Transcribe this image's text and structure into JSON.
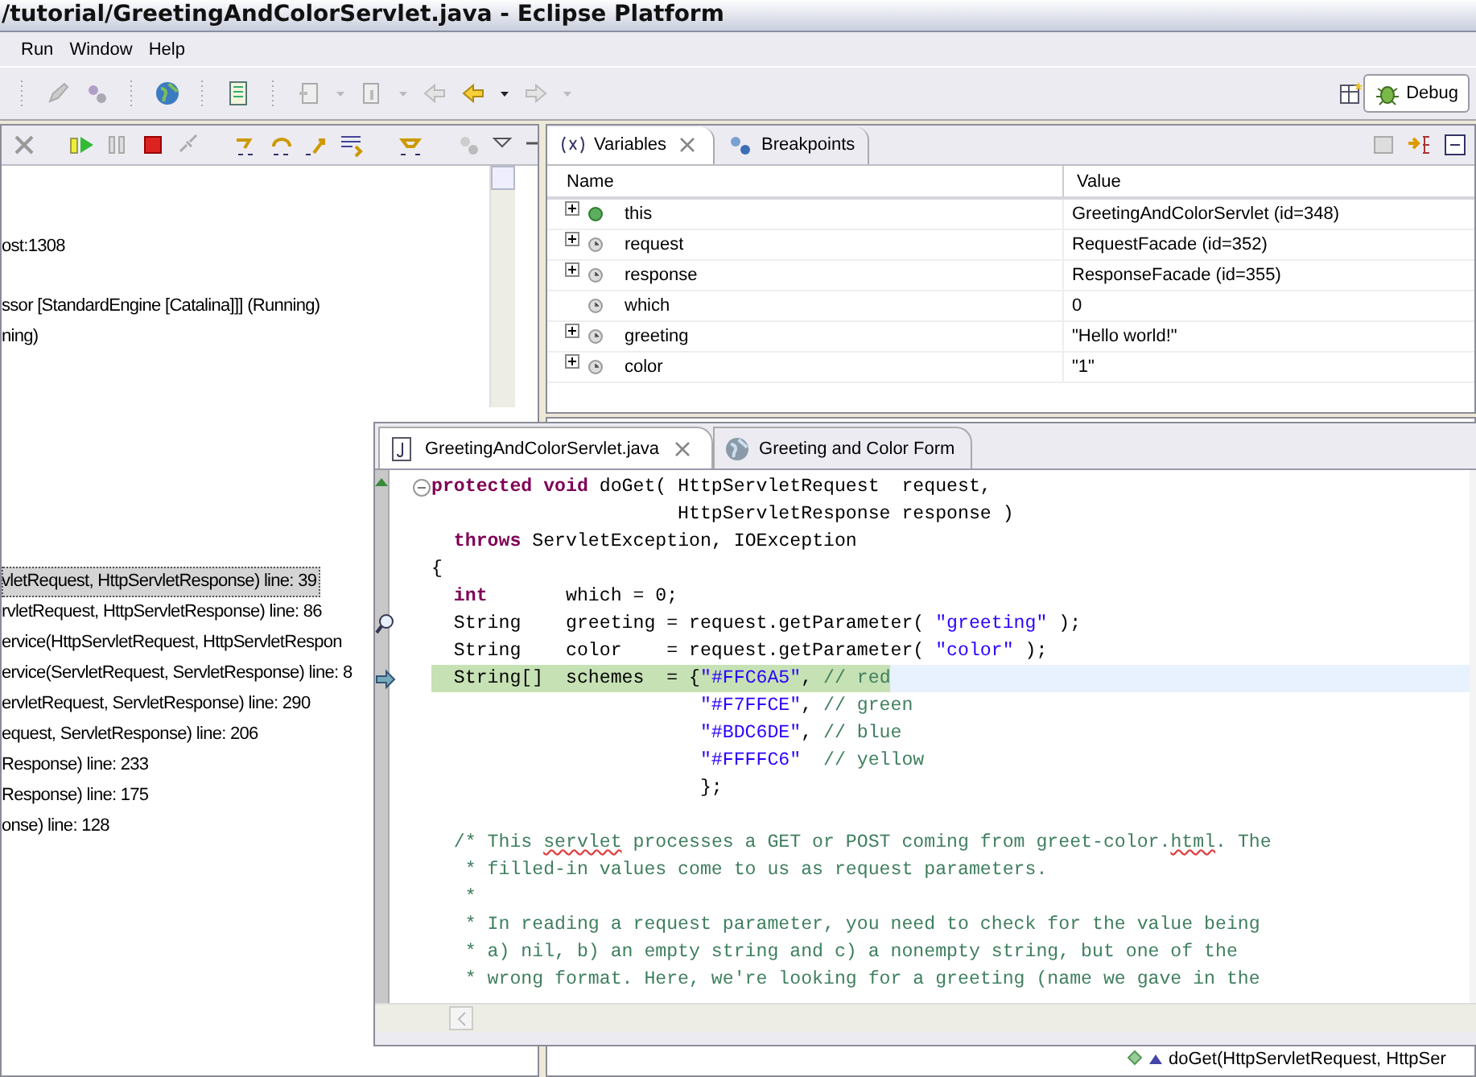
{
  "window": {
    "title": "/tutorial/GreetingAndColorServlet.java - Eclipse Platform"
  },
  "menu": [
    "Run",
    "Window",
    "Help"
  ],
  "perspective": {
    "label": "Debug",
    "selected": true
  },
  "debug_view": {
    "groups": [
      [
        {
          "text": "ost:1308",
          "selected": false
        }
      ],
      [
        {
          "text": "ssor [StandardEngine [Catalina]]]  (Running)",
          "selected": false
        },
        {
          "text": "ning)",
          "selected": false
        }
      ],
      [
        {
          "text": "vletRequest, HttpServletResponse) line: 39",
          "selected": true
        },
        {
          "text": "rvletRequest, HttpServletResponse) line: 86",
          "selected": false
        },
        {
          "text": "ervice(HttpServletRequest, HttpServletRespon",
          "selected": false
        },
        {
          "text": "ervice(ServletRequest, ServletResponse) line: 8",
          "selected": false
        },
        {
          "text": "ervletRequest, ServletResponse) line: 290",
          "selected": false
        },
        {
          "text": "equest, ServletResponse) line: 206",
          "selected": false
        },
        {
          "text": " Response) line: 233",
          "selected": false
        },
        {
          "text": "Response) line: 175",
          "selected": false
        },
        {
          "text": "onse) line: 128",
          "selected": false
        }
      ]
    ]
  },
  "variables_view": {
    "tabs": [
      {
        "label": "Variables",
        "selected": true,
        "closable": true
      },
      {
        "label": "Breakpoints",
        "selected": false,
        "closable": false
      }
    ],
    "columns": [
      "Name",
      "Value"
    ],
    "rows": [
      {
        "name": "this",
        "value": "GreetingAndColorServlet  (id=348)",
        "expandable": true,
        "kind": "this"
      },
      {
        "name": "request",
        "value": "RequestFacade  (id=352)",
        "expandable": true,
        "kind": "local"
      },
      {
        "name": "response",
        "value": "ResponseFacade  (id=355)",
        "expandable": true,
        "kind": "local"
      },
      {
        "name": "which",
        "value": "0",
        "expandable": false,
        "kind": "local"
      },
      {
        "name": "greeting",
        "value": "\"Hello world!\"",
        "expandable": true,
        "kind": "local"
      },
      {
        "name": "color",
        "value": "\"1\"",
        "expandable": true,
        "kind": "local"
      }
    ]
  },
  "editor": {
    "tabs": [
      {
        "label": "GreetingAndColorServlet.java",
        "selected": true,
        "closable": true,
        "kind": "java"
      },
      {
        "label": "Greeting and Color Form",
        "selected": false,
        "closable": false,
        "kind": "web"
      }
    ],
    "lines": [
      {
        "current": false,
        "kind": "foldable",
        "segments": [
          {
            "kind": "keyword",
            "text": "protected void"
          },
          {
            "kind": "plain",
            "text": " doGet( HttpServletRequest  request,"
          }
        ]
      },
      {
        "current": false,
        "kind": "plain",
        "segments": [
          {
            "kind": "plain",
            "text": "                      HttpServletResponse response )"
          }
        ]
      },
      {
        "current": false,
        "kind": "plain",
        "segments": [
          {
            "kind": "keyword",
            "text": "  throws"
          },
          {
            "kind": "plain",
            "text": " ServletException, IOException"
          }
        ]
      },
      {
        "current": false,
        "kind": "plain",
        "segments": [
          {
            "kind": "plain",
            "text": "{"
          }
        ]
      },
      {
        "current": false,
        "kind": "plain",
        "segments": [
          {
            "kind": "keyword",
            "text": "  int"
          },
          {
            "kind": "plain",
            "text": "       which = 0;"
          }
        ]
      },
      {
        "current": false,
        "kind": "inspected",
        "segments": [
          {
            "kind": "plain",
            "text": "  String    greeting = request.getParameter( "
          },
          {
            "kind": "string",
            "text": "\"greeting\""
          },
          {
            "kind": "plain",
            "text": " );"
          }
        ]
      },
      {
        "current": false,
        "kind": "plain",
        "segments": [
          {
            "kind": "plain",
            "text": "  String    color    = request.getParameter( "
          },
          {
            "kind": "string",
            "text": "\"color\""
          },
          {
            "kind": "plain",
            "text": " );"
          }
        ]
      },
      {
        "current": true,
        "kind": "pointer",
        "segments": [
          {
            "kind": "plain",
            "text": "  String[]  schemes  = {"
          },
          {
            "kind": "string",
            "text": "\"#FFC6A5\""
          },
          {
            "kind": "plain",
            "text": ", "
          },
          {
            "kind": "comment",
            "text": "// red"
          }
        ]
      },
      {
        "current": false,
        "kind": "plain",
        "segments": [
          {
            "kind": "string",
            "text": "                        \"#F7FFCE\""
          },
          {
            "kind": "plain",
            "text": ", "
          },
          {
            "kind": "comment",
            "text": "// green"
          }
        ]
      },
      {
        "current": false,
        "kind": "plain",
        "segments": [
          {
            "kind": "string",
            "text": "                        \"#BDC6DE\""
          },
          {
            "kind": "plain",
            "text": ", "
          },
          {
            "kind": "comment",
            "text": "// blue"
          }
        ]
      },
      {
        "current": false,
        "kind": "plain",
        "segments": [
          {
            "kind": "string",
            "text": "                        \"#FFFFC6\""
          },
          {
            "kind": "comment",
            "text": "  // yellow"
          }
        ]
      },
      {
        "current": false,
        "kind": "plain",
        "segments": [
          {
            "kind": "plain",
            "text": "                        };"
          }
        ]
      },
      {
        "current": false,
        "kind": "plain"
      },
      {
        "current": false,
        "kind": "plain",
        "segments": [
          {
            "kind": "comment",
            "text": "  /* This "
          },
          {
            "kind": "misspelled",
            "text": "servlet"
          },
          {
            "kind": "comment",
            "text": " processes a GET or POST coming from greet-color."
          },
          {
            "kind": "misspelled",
            "text": "html"
          },
          {
            "kind": "comment",
            "text": ". The"
          }
        ]
      },
      {
        "current": false,
        "kind": "plain",
        "segments": [
          {
            "kind": "comment",
            "text": "   * filled-in values come to us as request parameters."
          }
        ]
      },
      {
        "current": false,
        "kind": "plain",
        "segments": [
          {
            "kind": "comment",
            "text": "   *"
          }
        ]
      },
      {
        "current": false,
        "kind": "plain",
        "segments": [
          {
            "kind": "comment",
            "text": "   * In reading a request parameter, you need to check for the value being"
          }
        ]
      },
      {
        "current": false,
        "kind": "plain",
        "segments": [
          {
            "kind": "comment",
            "text": "   * a) nil, b) an empty string and c) a nonempty string, but one of the"
          }
        ]
      },
      {
        "current": false,
        "kind": "plain",
        "segments": [
          {
            "kind": "comment",
            "text": "   * wrong format. Here, we're looking for a greeting (name we gave in the"
          }
        ]
      }
    ]
  },
  "outline": {
    "item": "doGet(HttpServletRequest, HttpSer"
  }
}
